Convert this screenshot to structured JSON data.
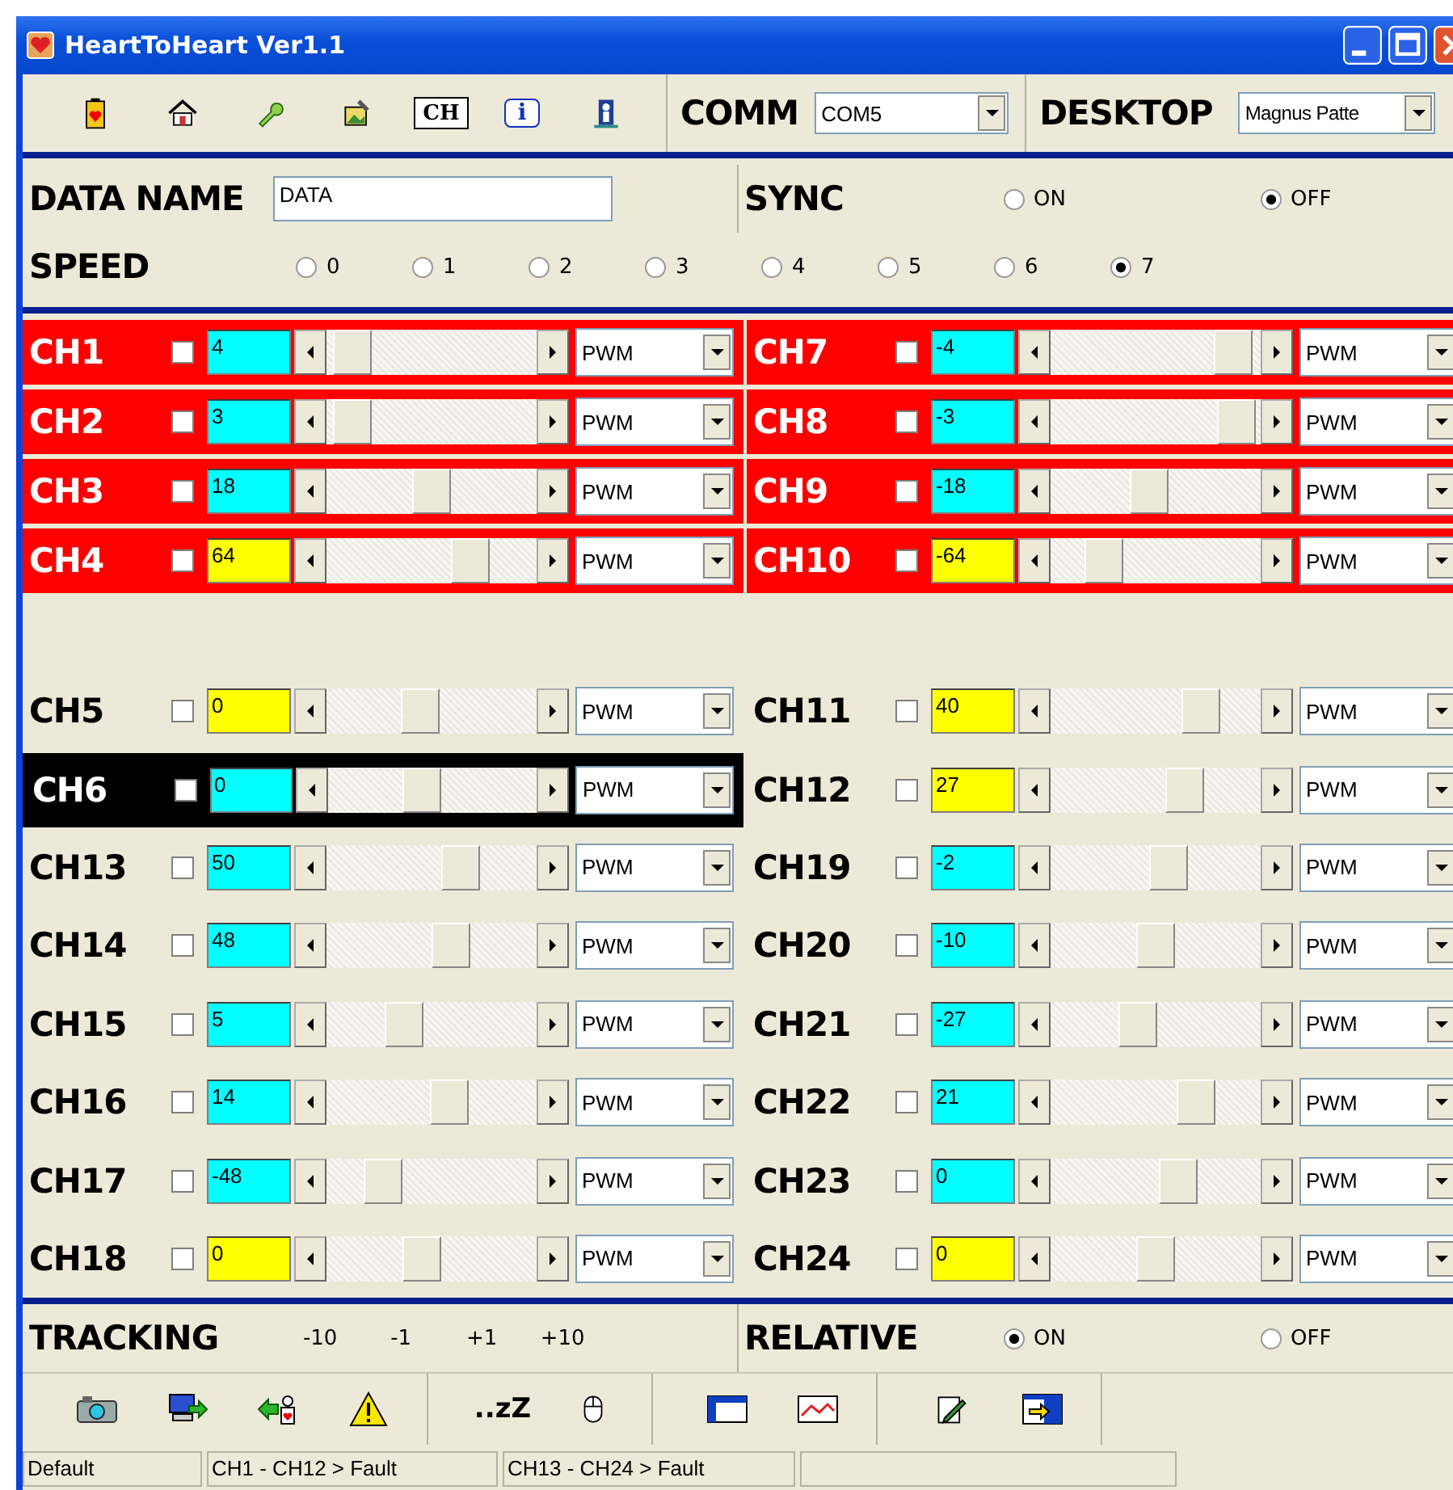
{
  "window": {
    "title": "HeartToHeart Ver1.1"
  },
  "toolbar": {
    "ch_label": "CH",
    "info_label": "i",
    "comm_label": "COMM",
    "comm_value": "COM5",
    "desktop_label": "DESKTOP",
    "desktop_value": "Magnus Patte"
  },
  "data_name": {
    "label": "DATA NAME",
    "value": "DATA"
  },
  "sync": {
    "label": "SYNC",
    "options": [
      {
        "label": "ON",
        "selected": false
      },
      {
        "label": "OFF",
        "selected": true
      }
    ]
  },
  "speed": {
    "label": "SPEED",
    "options": [
      {
        "label": "0",
        "selected": false
      },
      {
        "label": "1",
        "selected": false
      },
      {
        "label": "2",
        "selected": false
      },
      {
        "label": "3",
        "selected": false
      },
      {
        "label": "4",
        "selected": false
      },
      {
        "label": "5",
        "selected": false
      },
      {
        "label": "6",
        "selected": false
      },
      {
        "label": "7",
        "selected": true
      }
    ]
  },
  "top_rows": [
    {
      "channels": [
        {
          "name": "CH1",
          "kind": "fault",
          "checked": false,
          "value": "4",
          "color": "#00ffff",
          "level": 0.04,
          "mode": "PWM"
        },
        {
          "name": "CH7",
          "kind": "fault",
          "checked": false,
          "value": "-4",
          "color": "#00ffff",
          "level": 0.95,
          "mode": "PWM"
        }
      ]
    },
    {
      "channels": [
        {
          "name": "CH2",
          "kind": "fault",
          "checked": false,
          "value": "3",
          "color": "#00ffff",
          "level": 0.04,
          "mode": "PWM"
        },
        {
          "name": "CH8",
          "kind": "fault",
          "checked": false,
          "value": "-3",
          "color": "#00ffff",
          "level": 0.97,
          "mode": "PWM"
        }
      ]
    },
    {
      "channels": [
        {
          "name": "CH3",
          "kind": "fault",
          "checked": false,
          "value": "18",
          "color": "#00ffff",
          "level": 0.5,
          "mode": "PWM"
        },
        {
          "name": "CH9",
          "kind": "fault",
          "checked": false,
          "value": "-18",
          "color": "#00ffff",
          "level": 0.46,
          "mode": "PWM"
        }
      ]
    },
    {
      "channels": [
        {
          "name": "CH4",
          "kind": "fault",
          "checked": false,
          "value": "64",
          "color": "#ffff00",
          "level": 0.73,
          "mode": "PWM"
        },
        {
          "name": "CH10",
          "kind": "fault",
          "checked": false,
          "value": "-64",
          "color": "#ffff00",
          "level": 0.2,
          "mode": "PWM"
        }
      ]
    }
  ],
  "bottom_rows": [
    {
      "channels": [
        {
          "name": "CH5",
          "kind": "normal",
          "checked": false,
          "value": "0",
          "color": "#ffff00",
          "level": 0.43,
          "mode": "PWM"
        },
        {
          "name": "CH11",
          "kind": "normal",
          "checked": false,
          "value": "40",
          "color": "#ffff00",
          "level": 0.76,
          "mode": "PWM"
        }
      ]
    },
    {
      "channels": [
        {
          "name": "CH6",
          "kind": "selected",
          "checked": false,
          "value": "0",
          "color": "#00ffff",
          "level": 0.43,
          "mode": "PWM"
        },
        {
          "name": "CH12",
          "kind": "normal",
          "checked": false,
          "value": "27",
          "color": "#ffff00",
          "level": 0.67,
          "mode": "PWM"
        }
      ]
    },
    {
      "channels": [
        {
          "name": "CH13",
          "kind": "normal",
          "checked": false,
          "value": "50",
          "color": "#00ffff",
          "level": 0.67,
          "mode": "PWM"
        },
        {
          "name": "CH19",
          "kind": "normal",
          "checked": false,
          "value": "-2",
          "color": "#00ffff",
          "level": 0.58,
          "mode": "PWM"
        }
      ]
    },
    {
      "channels": [
        {
          "name": "CH14",
          "kind": "normal",
          "checked": false,
          "value": "48",
          "color": "#00ffff",
          "level": 0.61,
          "mode": "PWM"
        },
        {
          "name": "CH20",
          "kind": "normal",
          "checked": false,
          "value": "-10",
          "color": "#00ffff",
          "level": 0.5,
          "mode": "PWM"
        }
      ]
    },
    {
      "channels": [
        {
          "name": "CH15",
          "kind": "normal",
          "checked": false,
          "value": "5",
          "color": "#00ffff",
          "level": 0.34,
          "mode": "PWM"
        },
        {
          "name": "CH21",
          "kind": "normal",
          "checked": false,
          "value": "-27",
          "color": "#00ffff",
          "level": 0.4,
          "mode": "PWM"
        }
      ]
    },
    {
      "channels": [
        {
          "name": "CH16",
          "kind": "normal",
          "checked": false,
          "value": "14",
          "color": "#00ffff",
          "level": 0.6,
          "mode": "PWM"
        },
        {
          "name": "CH22",
          "kind": "normal",
          "checked": false,
          "value": "21",
          "color": "#00ffff",
          "level": 0.74,
          "mode": "PWM"
        }
      ]
    },
    {
      "channels": [
        {
          "name": "CH17",
          "kind": "normal",
          "checked": false,
          "value": "-48",
          "color": "#00ffff",
          "level": 0.22,
          "mode": "PWM"
        },
        {
          "name": "CH23",
          "kind": "normal",
          "checked": false,
          "value": "0",
          "color": "#00ffff",
          "level": 0.63,
          "mode": "PWM"
        }
      ]
    },
    {
      "channels": [
        {
          "name": "CH18",
          "kind": "normal",
          "checked": false,
          "value": "0",
          "color": "#ffff00",
          "level": 0.44,
          "mode": "PWM"
        },
        {
          "name": "CH24",
          "kind": "normal",
          "checked": false,
          "value": "0",
          "color": "#ffff00",
          "level": 0.5,
          "mode": "PWM"
        }
      ]
    }
  ],
  "tracking": {
    "label": "TRACKING",
    "steps": [
      "-10",
      "-1",
      "+1",
      "+10"
    ]
  },
  "relative": {
    "label": "RELATIVE",
    "options": [
      {
        "label": "ON",
        "selected": true
      },
      {
        "label": "OFF",
        "selected": false
      }
    ]
  },
  "bottom_toolbar": {
    "sleep_label": "..zZ"
  },
  "status_bar": [
    "Default",
    "CH1 - CH12 > Fault",
    "CH13 - CH24 > Fault"
  ]
}
